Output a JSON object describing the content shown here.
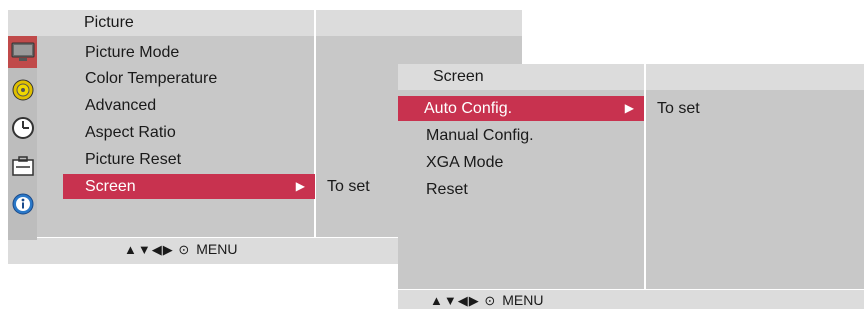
{
  "menu1": {
    "title": "Picture",
    "items": [
      {
        "label": "Picture Mode"
      },
      {
        "label": "Color Temperature"
      },
      {
        "label": "Advanced"
      },
      {
        "label": "Aspect Ratio"
      },
      {
        "label": "Picture Reset"
      },
      {
        "label": "Screen",
        "selected": true
      }
    ],
    "value": "To set",
    "nav_symbols": "▲▼◀▶ ⊙",
    "nav_label": "MENU"
  },
  "sidebar": {
    "icons": [
      "monitor-icon",
      "audio-disc-icon",
      "clock-icon",
      "toolbox-icon",
      "info-icon"
    ],
    "active_index": 0
  },
  "menu2": {
    "title": "Screen",
    "items": [
      {
        "label": "Auto Config.",
        "selected": true
      },
      {
        "label": "Manual Config."
      },
      {
        "label": "XGA Mode"
      },
      {
        "label": "Reset"
      }
    ],
    "value": "To set",
    "nav_symbols": "▲▼◀▶ ⊙",
    "nav_label": "MENU"
  },
  "colors": {
    "selected": "#c8324f",
    "panel": "#c8c8c8",
    "header": "#dcdcdc"
  }
}
